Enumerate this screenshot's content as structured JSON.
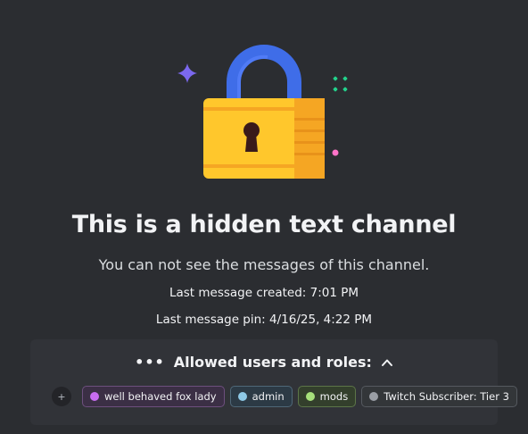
{
  "title": "This is a hidden text channel",
  "subtitle": "You can not see the messages of this channel.",
  "last_message_created_label": "Last message created:",
  "last_message_created_value": "7:01 PM",
  "last_message_pin_label": "Last message pin:",
  "last_message_pin_value": "4/16/25, 4:22 PM",
  "panel": {
    "title": "Allowed users and roles:",
    "add_label": "+",
    "roles": [
      {
        "label": "well behaved fox lady",
        "color": "#c86df0"
      },
      {
        "label": "admin",
        "color": "#8ec9e6"
      },
      {
        "label": "mods",
        "color": "#a6e07a"
      },
      {
        "label": "Twitch Subscriber: Tier 3",
        "color": "#9a9ea5"
      }
    ]
  },
  "colors": {
    "background": "#2b2d31",
    "panel": "#313338",
    "lock_body": "#ffc72c",
    "shackle": "#3f6de8"
  }
}
